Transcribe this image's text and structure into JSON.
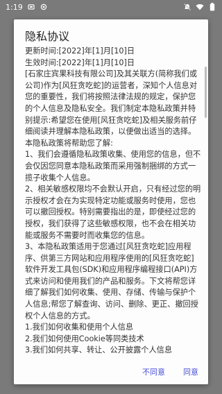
{
  "status_bar": {
    "time": "1:19",
    "left_icons": [
      "notification-a-icon",
      "notification-b-icon"
    ],
    "right_icons": [
      "notifications-off-icon",
      "wifi-icon",
      "battery-icon"
    ]
  },
  "dialog": {
    "title": "隐私协议",
    "paragraphs": [
      "更新时间:[2022]年[1]月[10]日",
      "生效时间:[2022]年[1]月[10]日",
      "[石家庄宾果科技有限公司]及其关联方(简称我们或公司)作为[风狂贪吃蛇]的运营者，深知个人信息对您的重要性，我们将按照法律法规的规定，保护您的个人信息及隐私安全。我们制定本隐私政策并特别提示:希望您在使用[风狂贪吃蛇]及相关服务前仔细阅读并理解本隐私政策，以便做出适当的选择。本隐私政策将帮助您了解:",
      "1、我们会遵循隐私政策收集、使用您的信息，但不会仅因您同意本隐私政策而采用强制捆绑的方式一揽子收集个人信息。",
      "2、相关敏感权限均不会默认开启，只有经过您的明示授权才会在为实现特定功能或服务时使用，您也可以撤回授权。特别需要指出的是，即使经过您的授权，我们获得了这些敏感权限，也不会在相关功能或服务不需要时而收集您的信息。",
      "3、本隐私政策适用于您通过[风狂贪吃蛇]应用程序、供第三方网站和应用程序使用的[风狂贪吃蛇]软件开发工具包(SDK)和应用程序编程接口(API)方式来访问和使用我们的产品和服务。下文将帮您详细了解我们如何收集、使用、存储、传输与保护个人信息;帮您了解查询、访问、删除、更正、撤回授权个人信息的方式。",
      "1.我们如何收集和使用个人信息",
      "2.我们如何使用Cookie等同类技术",
      "3.我们如何共享、转让、公开披露个人信息"
    ],
    "disagree_label": "不同意",
    "agree_label": "同意"
  }
}
